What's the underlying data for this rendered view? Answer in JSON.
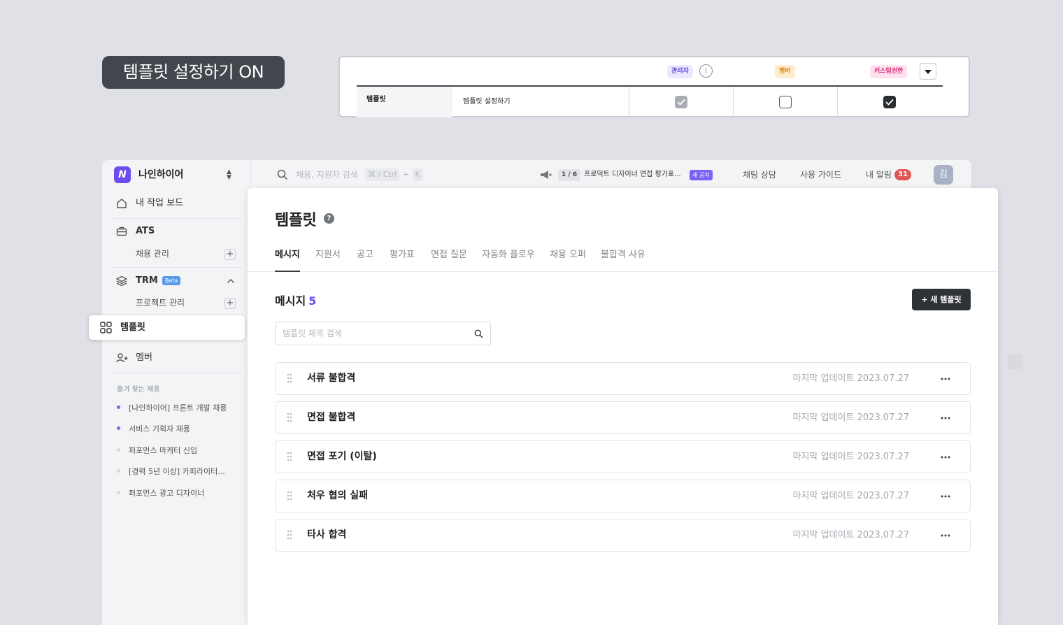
{
  "caption": "템플릿 설정하기 ON",
  "permission_table": {
    "roles": [
      "관리자",
      "멤버",
      "커스텀권한"
    ],
    "category": "템플릿",
    "permission_name": "템플릿 설정하기",
    "values": {
      "admin": "checked-disabled",
      "member": "unchecked",
      "custom": "checked"
    }
  },
  "topbar": {
    "workspace": "나인하이어",
    "search_placeholder": "채용, 지원자 검색",
    "shortcut_combo": "⌘ / Ctrl",
    "shortcut_plus": "+",
    "shortcut_key": "K",
    "notice_count": "1 / 6",
    "notice_text": "프로덕트 디자이너 면접 평가표...",
    "notice_badge": "새 공지",
    "chat": "채팅 상담",
    "guide": "사용 가이드",
    "alerts": "내 알림",
    "alert_count": "31",
    "avatar": "김"
  },
  "sidebar": {
    "dashboard": "내 작업 보드",
    "ats": "ATS",
    "ats_sub": "채용 관리",
    "trm": "TRM",
    "trm_badge": "Beta",
    "trm_sub": "프로젝트 관리",
    "template": "템플릿",
    "member": "멤버",
    "favorites_title": "즐겨 찾는 채용",
    "favorites": [
      {
        "label": "[나인하이어] 프론트 개발 채용",
        "color": "#7b61f5"
      },
      {
        "label": "서비스 기획자 채용",
        "color": "#7b61f5"
      },
      {
        "label": "퍼포먼스 마케터 신입",
        "color": "#c9ccd2"
      },
      {
        "label": "[경력 5년 이상] 카피라이터...",
        "color": "#c9ccd2"
      },
      {
        "label": "퍼포먼스 광고 디자이너",
        "color": "#c9ccd2"
      }
    ]
  },
  "main": {
    "title": "템플릿",
    "tabs": [
      "메시지",
      "지원서",
      "공고",
      "평가표",
      "면접 질문",
      "자동화 플로우",
      "채용 오퍼",
      "불합격 사유"
    ],
    "active_tab": "메시지",
    "section_title": "메시지",
    "section_count": "5",
    "new_button": "+ 새 템플릿",
    "search_placeholder": "템플릿 제목 검색",
    "templates": [
      {
        "name": "서류 불합격",
        "updated": "마지막 업데이트 2023.07.27"
      },
      {
        "name": "면접 불합격",
        "updated": "마지막 업데이트 2023.07.27"
      },
      {
        "name": "면접 포기 (이탈)",
        "updated": "마지막 업데이트 2023.07.27"
      },
      {
        "name": "처우 협의 실패",
        "updated": "마지막 업데이트 2023.07.27"
      },
      {
        "name": "타사 합격",
        "updated": "마지막 업데이트 2023.07.27"
      }
    ]
  },
  "colors": {
    "accent": "#6a4cf0",
    "dark": "#2f3237",
    "alert": "#e25555"
  }
}
